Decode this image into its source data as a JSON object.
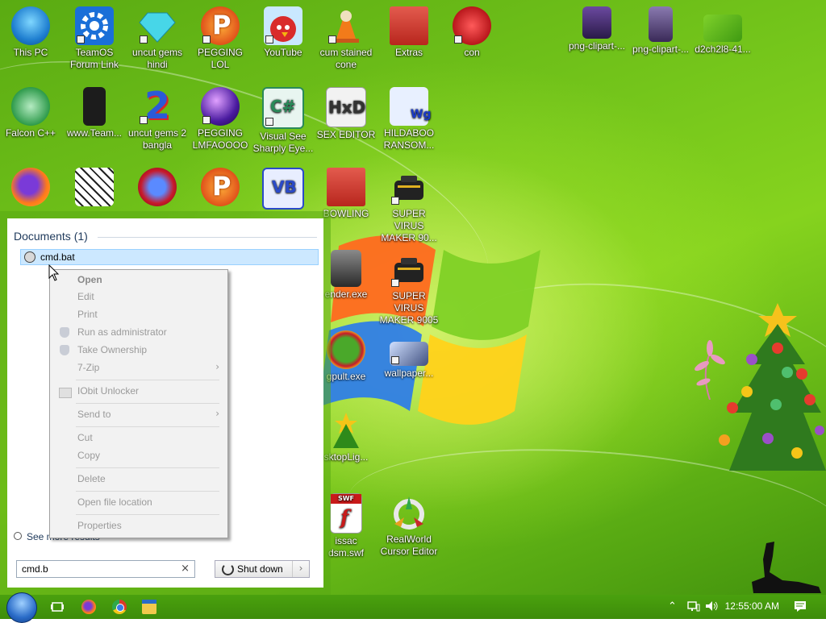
{
  "desktop": {
    "icons": [
      {
        "label": "This PC"
      },
      {
        "label": "TeamOS\nForum Link"
      },
      {
        "label": "uncut gems\nhindi"
      },
      {
        "label": "PEGGING LOL"
      },
      {
        "label": "YouTube"
      },
      {
        "label": "cum stained\ncone"
      },
      {
        "label": "Extras"
      },
      {
        "label": "con"
      },
      {
        "label": "png-clipart-..."
      },
      {
        "label": "png-clipart-..."
      },
      {
        "label": "d2ch2l8-41..."
      },
      {
        "label": "Falcon C++"
      },
      {
        "label": "www.Team..."
      },
      {
        "label": "uncut gems 2\nbangla"
      },
      {
        "label": "PEGGING\nLMFAOOOO"
      },
      {
        "label": "Visual See\nSharply Eye..."
      },
      {
        "label": "SEX EDITOR"
      },
      {
        "label": "HILDABOO\nRANSOM..."
      },
      {
        "label": ""
      },
      {
        "label": ""
      },
      {
        "label": ""
      },
      {
        "label": ""
      },
      {
        "label": ""
      },
      {
        "label": "BOWLING"
      },
      {
        "label": "SUPER VIRUS\nMAKER 90..."
      },
      {
        "label": "ender.exe"
      },
      {
        "label": "SUPER VIRUS\nMAKER 9005"
      },
      {
        "label": "gpult.exe"
      },
      {
        "label": "wallpaper..."
      },
      {
        "label": "sktopLig..."
      },
      {
        "label": "issac\ndsm.swf"
      },
      {
        "label": "RealWorld\nCursor Editor"
      }
    ]
  },
  "start_menu": {
    "section_title": "Documents (1)",
    "result": {
      "label": "cmd.bat"
    },
    "see_more": "See more results",
    "search": {
      "value": "cmd.b",
      "clear_icon": "×"
    },
    "shutdown": {
      "label": "Shut down",
      "arrow": "›"
    }
  },
  "context_menu": {
    "items": [
      {
        "label": "Open"
      },
      {
        "label": "Edit"
      },
      {
        "label": "Print"
      },
      {
        "label": "Run as administrator"
      },
      {
        "label": "Take Ownership"
      },
      {
        "label": "7-Zip"
      },
      {
        "label": "IObit Unlocker"
      },
      {
        "label": "Send to"
      },
      {
        "label": "Cut"
      },
      {
        "label": "Copy"
      },
      {
        "label": "Delete"
      },
      {
        "label": "Open file location"
      },
      {
        "label": "Properties"
      }
    ],
    "submenu_arrow": "›"
  },
  "taskbar": {
    "clock": "12:55:00 AM",
    "icons": [
      "start-orb-icon",
      "task-view-icon",
      "firefox-icon",
      "chrome-icon",
      "file-explorer-icon"
    ],
    "tray_icons": [
      "chevron-up-icon",
      "network-icon",
      "speaker-icon",
      "notification-icon"
    ]
  },
  "colors": {
    "desktop_green": "#74c51b",
    "selection": "#cce8ff",
    "menu_disabled_text": "#9a9a9a"
  }
}
